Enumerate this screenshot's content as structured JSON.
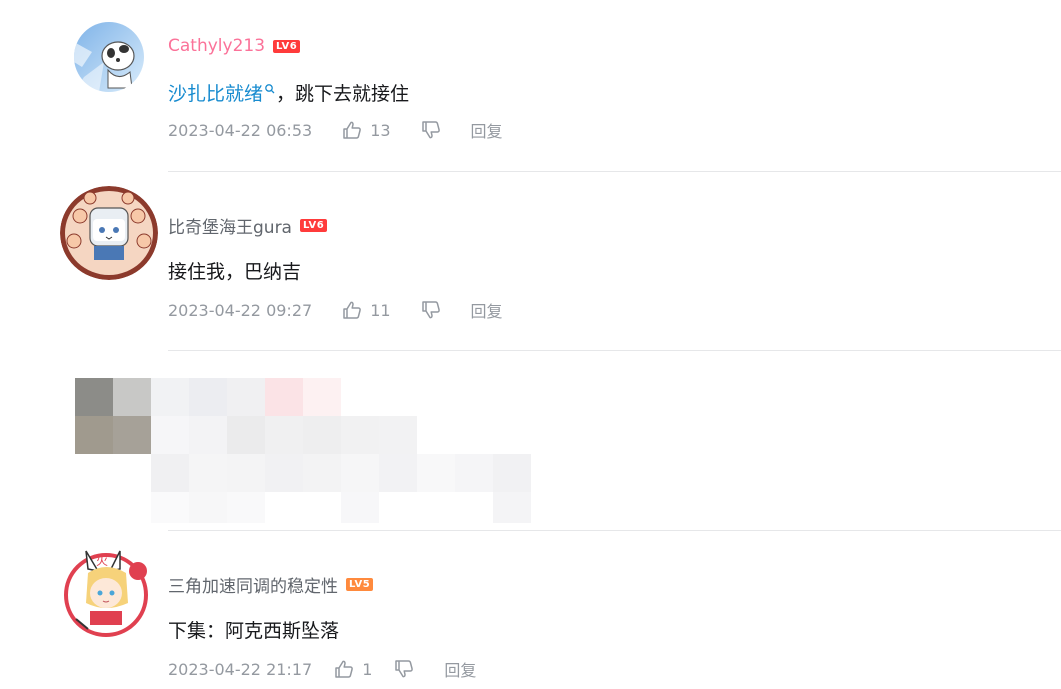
{
  "comments": [
    {
      "username": "Cathyly213",
      "level": "LV6",
      "content_link": "沙扎比就绪",
      "content_rest": "，跳下去就接住",
      "time": "2023-04-22 06:53",
      "likes": "13",
      "reply": "回复"
    },
    {
      "username": "比奇堡海王gura",
      "level": "LV6",
      "content": "接住我，巴纳吉",
      "time": "2023-04-22 09:27",
      "likes": "11",
      "reply": "回复"
    },
    {
      "username": "三角加速同调的稳定性",
      "level": "LV5",
      "content": "下集：阿克西斯坠落",
      "time": "2023-04-22 21:17",
      "likes": "1",
      "reply": "回复"
    }
  ],
  "colors": {
    "vip_name": "#fb7299",
    "link": "#178bcf",
    "meta": "#9499a0",
    "lv6": "#ff3b3b",
    "lv5": "#ff8a3d"
  }
}
